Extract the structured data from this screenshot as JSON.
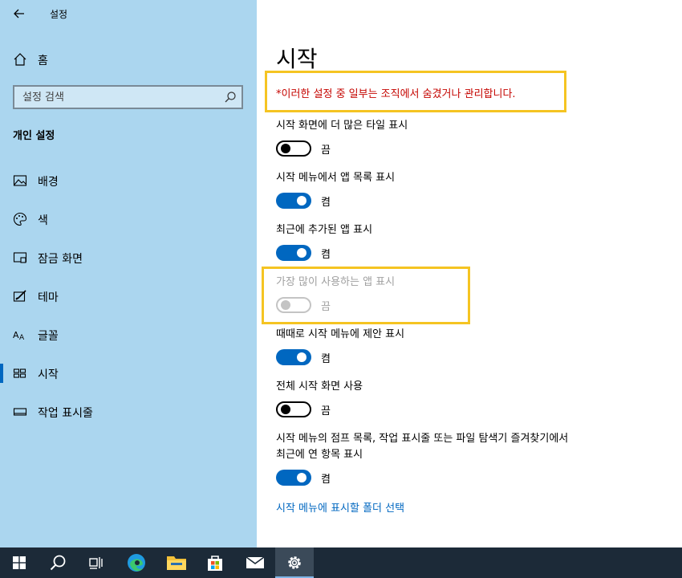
{
  "window": {
    "title": "설정"
  },
  "sidebar": {
    "home_label": "홈",
    "search_placeholder": "설정 검색",
    "section_title": "개인 설정",
    "items": [
      {
        "label": "배경",
        "icon": "image-icon"
      },
      {
        "label": "색",
        "icon": "palette-icon"
      },
      {
        "label": "잠금 화면",
        "icon": "lock-screen-icon"
      },
      {
        "label": "테마",
        "icon": "theme-icon"
      },
      {
        "label": "글꼴",
        "icon": "font-icon"
      },
      {
        "label": "시작",
        "icon": "start-icon",
        "active": true
      },
      {
        "label": "작업 표시줄",
        "icon": "taskbar-icon"
      }
    ]
  },
  "main": {
    "title": "시작",
    "notice": "*이러한 설정 중 일부는 조직에서 숨겼거나 관리합니다.",
    "options": [
      {
        "label": "시작 화면에 더 많은 타일 표시",
        "state": "off",
        "state_label": "끔"
      },
      {
        "label": "시작 메뉴에서 앱 목록 표시",
        "state": "on",
        "state_label": "켬"
      },
      {
        "label": "최근에 추가된 앱 표시",
        "state": "on",
        "state_label": "켬"
      },
      {
        "label": "가장 많이 사용하는 앱 표시",
        "state": "disabled",
        "state_label": "끔"
      },
      {
        "label": "때때로 시작 메뉴에 제안 표시",
        "state": "on",
        "state_label": "켬"
      },
      {
        "label": "전체 시작 화면 사용",
        "state": "off",
        "state_label": "끔"
      },
      {
        "label_line1": "시작 메뉴의 점프 목록, 작업 표시줄 또는 파일 탐색기 즐겨찾기에서",
        "label_line2": "최근에 연 항목 표시",
        "state": "on",
        "state_label": "켬"
      }
    ],
    "link": "시작 메뉴에 표시할 폴더 선택"
  },
  "colors": {
    "sidebar_bg": "#abd6ef",
    "accent": "#0067c0",
    "notice_text": "#c50500",
    "highlight": "#f5c422",
    "taskbar_bg": "#1c2a38"
  },
  "taskbar": {
    "items": [
      "windows-start-icon",
      "search-icon",
      "task-view-icon",
      "edge-icon",
      "file-explorer-icon",
      "store-icon",
      "mail-icon",
      "settings-icon"
    ]
  }
}
